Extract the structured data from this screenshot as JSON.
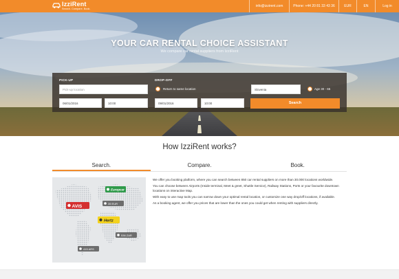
{
  "header": {
    "logo_name": "IzziRent",
    "logo_tagline": "Search. Compare. Book.",
    "email": "info@izzirent.com",
    "phone": "Phone: +44 20 81 33 43 36",
    "currency": "EUR",
    "language": "EN",
    "login": "Log in"
  },
  "hero": {
    "title": "YOUR CAR RENTAL CHOICE ASSISTANT",
    "subtitle": "We compare car rental suppliers from IzziRent"
  },
  "search": {
    "pickup_label": "PICK-UP",
    "dropoff_label": "DROP-OFF",
    "pickup_location_placeholder": "Pick-up location",
    "return_same_label": "Return to same location",
    "country": "Slovenia",
    "age_label": "Age 30 - 65",
    "pickup_date": "06/01/2016",
    "pickup_time": "10:00",
    "dropoff_date": "09/01/2016",
    "dropoff_time": "10:00",
    "search_button": "Search"
  },
  "how": {
    "title": "How IzziRent works?",
    "tabs": [
      "Search.",
      "Compare.",
      "Book."
    ],
    "active_tab": 0,
    "paragraphs": [
      "We offer you booking platform, where you can search between 850 car rental suppliers on more than 30.000 locations worldwide.",
      "You can choose between Airports (Inside terminal, Meet & greet, Shuttle Service), Railway Stations, Ports or your favourite downtown locations on interactive Map.",
      "With easy to use map tools you can narrow down your optimal rental location, or customize one way drop/off locations, if available.",
      "As a booking agent, we offer you prices that are lower than the ones you could get when renting with suppliers directly."
    ]
  },
  "map_pins": {
    "europcar": "Europcar",
    "avis": "AVIS",
    "hertz": "Hertz",
    "price1": "35 EUR",
    "price2": "536 ZAR",
    "price3": "415 ARS"
  },
  "colors": {
    "accent": "#f28b2a",
    "avis": "#d42f2f",
    "europcar": "#2f9a4a",
    "hertz": "#f3d21d",
    "pin_grey": "#6d6d6d"
  }
}
